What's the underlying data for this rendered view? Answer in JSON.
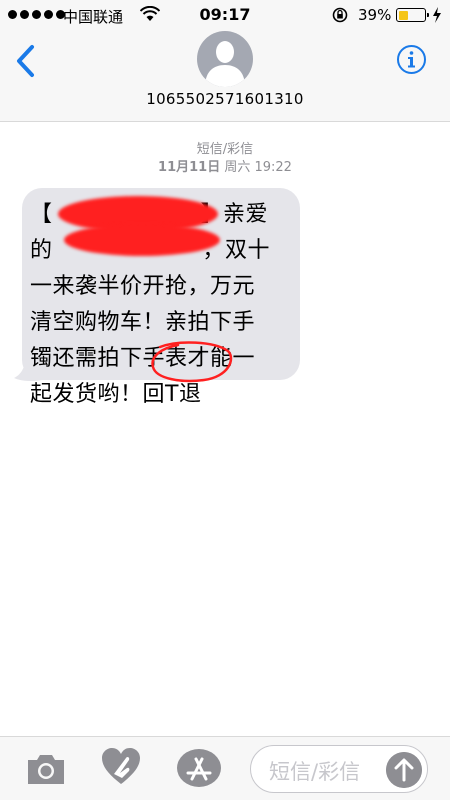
{
  "status_bar": {
    "carrier": "中国联通",
    "time": "09:17",
    "battery_percent": "39%",
    "battery_level": 0.39,
    "battery_color": "#f5c518"
  },
  "header": {
    "contact_number": "1065502571601310",
    "back_icon": "chevron-left-icon",
    "info_icon": "info-icon",
    "accent_color": "#1a7ae8"
  },
  "conversation": {
    "type_label": "短信/彩信",
    "date": "11月11日",
    "weekday_time": "周六 19:22",
    "message": {
      "line1_bracket_open": "【",
      "line1_bracket_close": "】亲爱",
      "line2_start": "的",
      "line2_end": "，双十",
      "line3": "一来袭半价开抢，万元",
      "line4": "清空购物车！亲拍下手",
      "line5": "镯还需拍下手表才能一",
      "line6": "起发货哟！回T退"
    },
    "bubble_color": "#e5e5ea",
    "annotation_color": "#ff2020"
  },
  "toolbar": {
    "camera_icon": "camera-icon",
    "digital_touch_icon": "heart-hand-icon",
    "apps_icon": "app-store-icon",
    "input_placeholder": "短信/彩信",
    "send_icon": "send-arrow-icon"
  }
}
